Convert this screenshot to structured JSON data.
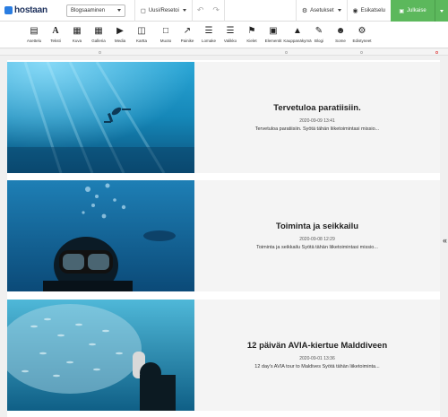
{
  "brand": {
    "name": "hostaan"
  },
  "header": {
    "page_select": "Blogsaaminen",
    "new_reset": "Uusi/Resetoi",
    "settings": "Asetukset",
    "preview": "Esikatselu",
    "publish": "Julkaise"
  },
  "toolbar": [
    {
      "label": "Asettelu",
      "icon": "layout-icon"
    },
    {
      "label": "Teksti",
      "icon": "text-icon"
    },
    {
      "label": "Kuva",
      "icon": "image-icon"
    },
    {
      "label": "Galleria",
      "icon": "gallery-icon"
    },
    {
      "label": "Media",
      "icon": "media-icon"
    },
    {
      "label": "Kartta",
      "icon": "map-icon"
    },
    {
      "label": "Muoto",
      "icon": "shape-icon"
    },
    {
      "label": "Painike",
      "icon": "button-icon"
    },
    {
      "label": "Lomake",
      "icon": "form-icon"
    },
    {
      "label": "Valikko",
      "icon": "menu-icon"
    },
    {
      "label": "Kielet",
      "icon": "languages-icon"
    },
    {
      "label": "Elementit",
      "icon": "elements-icon"
    },
    {
      "label": "Kauppanäkymä",
      "icon": "cart-icon"
    },
    {
      "label": "Blogi",
      "icon": "blog-icon"
    },
    {
      "label": "Some",
      "icon": "social-icon"
    },
    {
      "label": "Edistyneet",
      "icon": "advanced-icon"
    }
  ],
  "posts": [
    {
      "title": "Tervetuloa paratiisiin.",
      "date": "2020-09-09 13:41",
      "excerpt": "Tervetuloa paratiisiin.   Syötä tähän liiketoimintasi missio..."
    },
    {
      "title": "Toiminta ja seikkailu",
      "date": "2020-09-08 12:29",
      "excerpt": "Toiminta ja seikkailu   Syötä tähän liiketoimintasi missio..."
    },
    {
      "title": "12 päivän AVIA-kiertue Malddiveen",
      "date": "2020-09-01 13:36",
      "excerpt": "12 day's AVIA tour to Maldives   Syötä tähän liiketoiminta..."
    }
  ],
  "colors": {
    "publish": "#5cb85c",
    "brand": "#1b2f5b",
    "accent": "#2a7de1"
  }
}
